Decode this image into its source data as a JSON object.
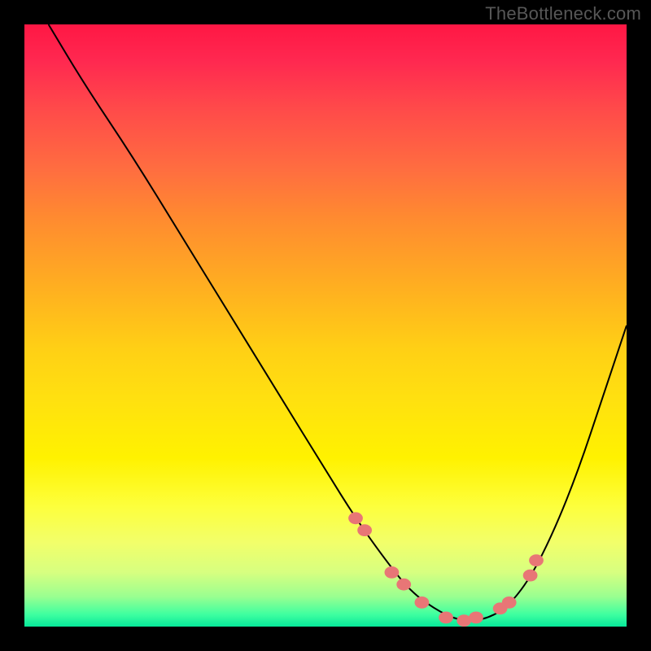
{
  "watermark": "TheBottleneck.com",
  "chart_data": {
    "type": "line",
    "title": "",
    "xlabel": "",
    "ylabel": "",
    "xlim": [
      0,
      100
    ],
    "ylim": [
      0,
      100
    ],
    "grid": false,
    "legend": false,
    "series": [
      {
        "name": "curve",
        "x": [
          4,
          10,
          18,
          26,
          34,
          42,
          50,
          55,
          60,
          64,
          68,
          72,
          76,
          80,
          84,
          88,
          92,
          96,
          100
        ],
        "y": [
          100,
          90,
          78,
          65,
          52,
          39,
          26,
          18,
          11,
          6,
          3,
          1,
          1,
          3,
          8,
          16,
          26,
          38,
          50
        ]
      }
    ],
    "markers": {
      "name": "points",
      "color": "#e87676",
      "x": [
        55,
        56.5,
        61,
        63,
        66,
        70,
        73,
        75,
        79,
        80.5,
        84,
        85
      ],
      "y": [
        18,
        16,
        9,
        7,
        4,
        1.5,
        1,
        1.5,
        3,
        4,
        8.5,
        11
      ]
    },
    "gradient_colors": {
      "top": "#ff1744",
      "mid": "#fff200",
      "bottom": "#06e89a"
    }
  }
}
